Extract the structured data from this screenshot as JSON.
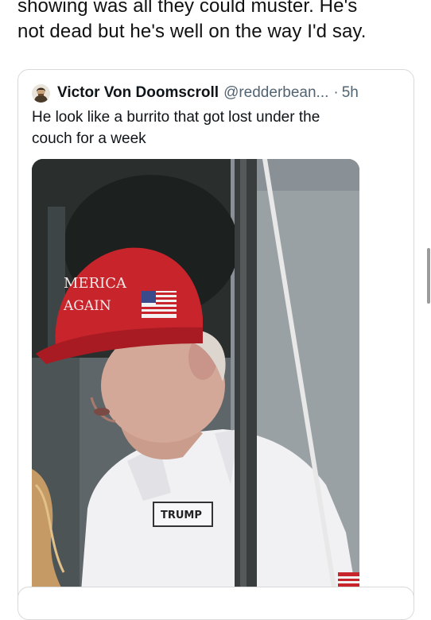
{
  "post": {
    "text_lines": [
      "showing was all they could muster. He's",
      "not dead but he's well on the way I'd say."
    ]
  },
  "quote": {
    "author_name": "Victor Von Doomscroll",
    "author_handle": "@redderbean...",
    "separator": "·",
    "timestamp": "5h",
    "avatar_icon": "avatar-icon",
    "text_lines": [
      "He look like a burrito that got lost under the",
      "couch for a week"
    ]
  },
  "media": {
    "cap_text_line1": "MERICA",
    "cap_text_line2": "AGAIN",
    "shirt_logo": "TRUMP"
  },
  "colors": {
    "text_primary": "#0f1419",
    "text_secondary": "#536471",
    "border": "#d9d9d9",
    "cap_red": "#c8242b"
  }
}
